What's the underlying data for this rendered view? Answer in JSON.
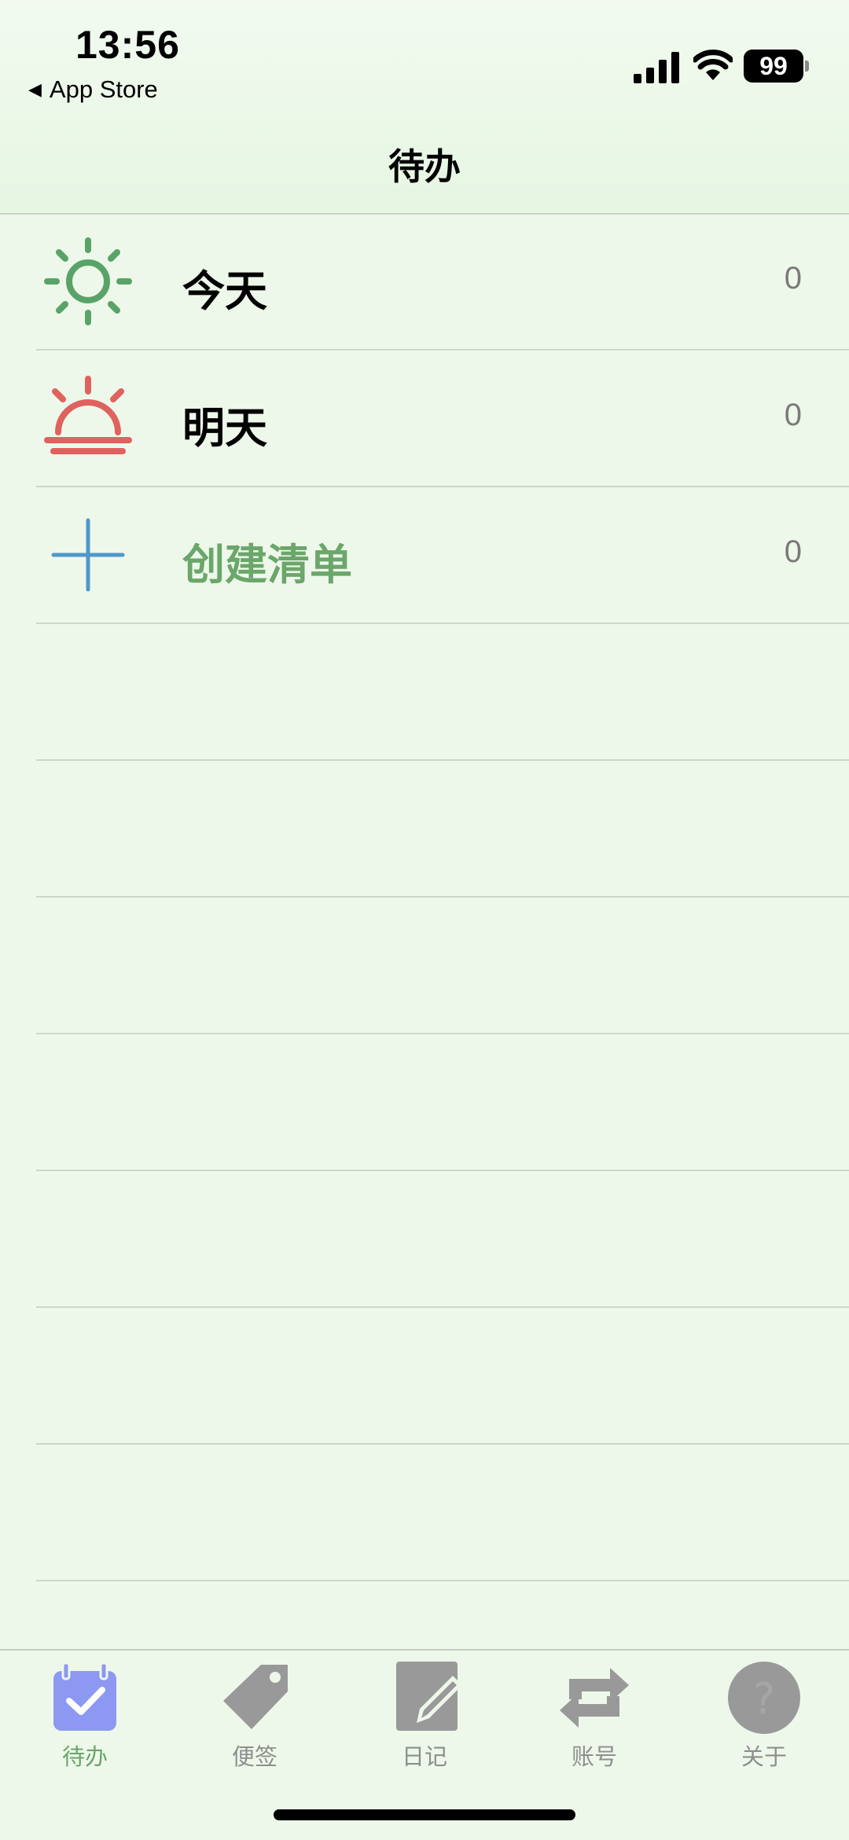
{
  "status_bar": {
    "time": "13:56",
    "back_app": "App Store",
    "battery": "99"
  },
  "nav": {
    "title": "待办"
  },
  "list": {
    "items": [
      {
        "label": "今天",
        "count": "0",
        "icon": "sun-icon",
        "color": "#5aa368"
      },
      {
        "label": "明天",
        "count": "0",
        "icon": "sunrise-icon",
        "color": "#e0625f"
      },
      {
        "label": "创建清单",
        "count": "0",
        "icon": "plus-icon",
        "color": "#4f98cc"
      }
    ]
  },
  "tab_bar": {
    "active_color": "#6ba66a",
    "inactive_color": "#8e8e8e",
    "tabs": [
      {
        "label": "待办",
        "icon": "calendar-check-icon",
        "active": true
      },
      {
        "label": "便签",
        "icon": "tag-icon",
        "active": false
      },
      {
        "label": "日记",
        "icon": "note-pen-icon",
        "active": false
      },
      {
        "label": "账号",
        "icon": "swap-arrows-icon",
        "active": false
      },
      {
        "label": "关于",
        "icon": "question-icon",
        "active": false
      }
    ]
  }
}
